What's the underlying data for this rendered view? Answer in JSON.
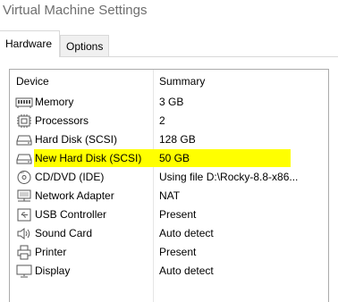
{
  "window": {
    "title": "Virtual Machine Settings"
  },
  "tabs": [
    {
      "label": "Hardware",
      "active": true
    },
    {
      "label": "Options",
      "active": false
    }
  ],
  "table": {
    "columns": {
      "device": "Device",
      "summary": "Summary"
    },
    "rows": [
      {
        "icon": "memory-icon",
        "device": "Memory",
        "summary": "3 GB"
      },
      {
        "icon": "processor-icon",
        "device": "Processors",
        "summary": "2"
      },
      {
        "icon": "hard-disk-icon",
        "device": "Hard Disk (SCSI)",
        "summary": "128 GB"
      },
      {
        "icon": "hard-disk-icon",
        "device": "New Hard Disk (SCSI)",
        "summary": "50 GB",
        "selected": true
      },
      {
        "icon": "cd-dvd-icon",
        "device": "CD/DVD (IDE)",
        "summary": "Using file D:\\Rocky-8.8-x86..."
      },
      {
        "icon": "network-adapter-icon",
        "device": "Network Adapter",
        "summary": "NAT"
      },
      {
        "icon": "usb-icon",
        "device": "USB Controller",
        "summary": "Present"
      },
      {
        "icon": "sound-card-icon",
        "device": "Sound Card",
        "summary": "Auto detect"
      },
      {
        "icon": "printer-icon",
        "device": "Printer",
        "summary": "Present"
      },
      {
        "icon": "display-icon",
        "device": "Display",
        "summary": "Auto detect"
      }
    ]
  },
  "colors": {
    "highlight": "#ffff00",
    "title_text": "#6e6e6e",
    "border": "#ababab"
  }
}
